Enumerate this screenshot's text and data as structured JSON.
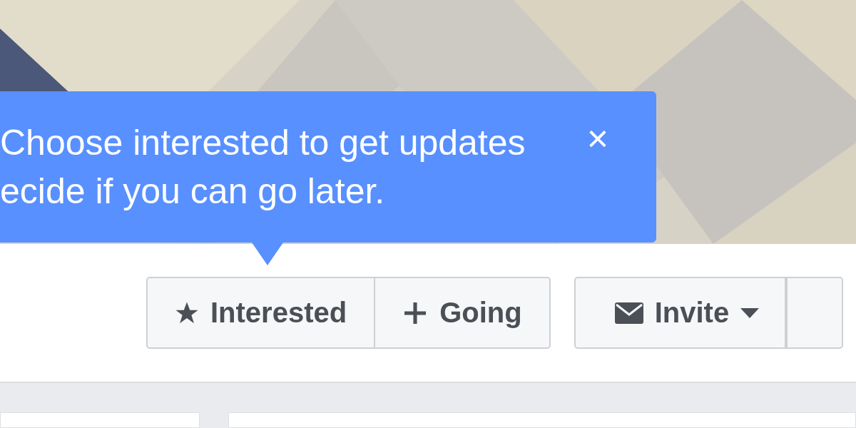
{
  "tooltip": {
    "lines": [
      "Choose interested to get updates",
      "ecide if you can go later."
    ],
    "close": "×"
  },
  "rsvp_buttons": [
    {
      "kind": "interested",
      "label": "Interested"
    },
    {
      "kind": "going",
      "label": "Going"
    }
  ],
  "invite_button": {
    "label": "Invite"
  }
}
